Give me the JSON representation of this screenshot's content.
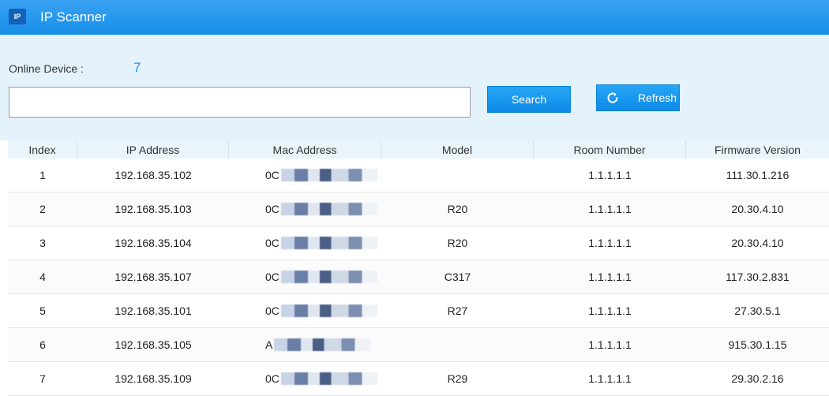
{
  "window": {
    "icon_text": "IP",
    "title": "IP Scanner"
  },
  "online": {
    "label": "Online Device :",
    "count": "7"
  },
  "search": {
    "value": "",
    "button_label": "Search"
  },
  "refresh": {
    "icon": "refresh-icon",
    "label": "Refresh"
  },
  "colors": {
    "title_bar": "#1a8fe9",
    "accent": "#1a8de9",
    "band": "#e3f2fb"
  },
  "table": {
    "headers": [
      "Index",
      "IP Address",
      "Mac Address",
      "Model",
      "Room Number",
      "Firmware Version"
    ],
    "rows": [
      {
        "index": "1",
        "ip": "192.168.35.102",
        "mac": "0C",
        "model": "",
        "room": "1.1.1.1.1",
        "firmware": "111.30.1.216"
      },
      {
        "index": "2",
        "ip": "192.168.35.103",
        "mac": "0C",
        "model": "R20",
        "room": "1.1.1.1.1",
        "firmware": "20.30.4.10"
      },
      {
        "index": "3",
        "ip": "192.168.35.104",
        "mac": "0C",
        "model": "R20",
        "room": "1.1.1.1.1",
        "firmware": "20.30.4.10"
      },
      {
        "index": "4",
        "ip": "192.168.35.107",
        "mac": "0C",
        "model": "C317",
        "room": "1.1.1.1.1",
        "firmware": "117.30.2.831"
      },
      {
        "index": "5",
        "ip": "192.168.35.101",
        "mac": "0C",
        "model": "R27",
        "room": "1.1.1.1.1",
        "firmware": "27.30.5.1"
      },
      {
        "index": "6",
        "ip": "192.168.35.105",
        "mac": "A",
        "model": "",
        "room": "1.1.1.1.1",
        "firmware": "915.30.1.15"
      },
      {
        "index": "7",
        "ip": "192.168.35.109",
        "mac": "0C",
        "model": "R29",
        "room": "1.1.1.1.1",
        "firmware": "29.30.2.16"
      }
    ]
  }
}
